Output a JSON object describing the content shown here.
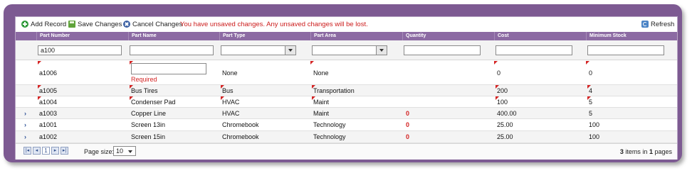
{
  "toolbar": {
    "add_label": "Add Record",
    "save_label": "Save Changes",
    "cancel_label": "Cancel Changes",
    "warning": "You have unsaved changes. Any unsaved changes will be lost.",
    "refresh_label": "Refresh"
  },
  "columns": [
    "Part Number",
    "Part Name",
    "Part Type",
    "Part Area",
    "Quantity",
    "Cost",
    "Minimum Stock"
  ],
  "filters": {
    "part_number": "a100",
    "part_name": "",
    "quantity": "",
    "cost": "",
    "minimum_stock": ""
  },
  "new_row": {
    "part_number": "a1006",
    "part_name": "",
    "validation": "Required",
    "part_type": "None",
    "part_area": "None",
    "cost": "0",
    "minimum_stock": "0"
  },
  "rows": [
    {
      "part_number": "a1005",
      "part_name": "Bus Tires",
      "part_type": "Bus",
      "part_area": "Transportation",
      "quantity": "",
      "cost": "200",
      "minimum_stock": "4"
    },
    {
      "part_number": "a1004",
      "part_name": "Condenser Pad",
      "part_type": "HVAC",
      "part_area": "Maint",
      "quantity": "",
      "cost": "100",
      "minimum_stock": "5"
    },
    {
      "part_number": "a1003",
      "part_name": "Copper Line",
      "part_type": "HVAC",
      "part_area": "Maint",
      "quantity": "0",
      "cost": "400.00",
      "minimum_stock": "5"
    },
    {
      "part_number": "a1001",
      "part_name": "Screen 13in",
      "part_type": "Chromebook",
      "part_area": "Technology",
      "quantity": "0",
      "cost": "25.00",
      "minimum_stock": "100"
    },
    {
      "part_number": "a1002",
      "part_name": "Screen 15in",
      "part_type": "Chromebook",
      "part_area": "Technology",
      "quantity": "0",
      "cost": "25.00",
      "minimum_stock": "100"
    }
  ],
  "pager": {
    "current_page": "1",
    "page_size_label": "Page size:",
    "page_size": "10",
    "items_count": "3",
    "items_text": "items in",
    "pages_count": "1",
    "pages_text": "pages"
  },
  "colors": {
    "header": "#8c6aa3",
    "frame": "#7d5a92",
    "warning": "#cc1b1b"
  }
}
